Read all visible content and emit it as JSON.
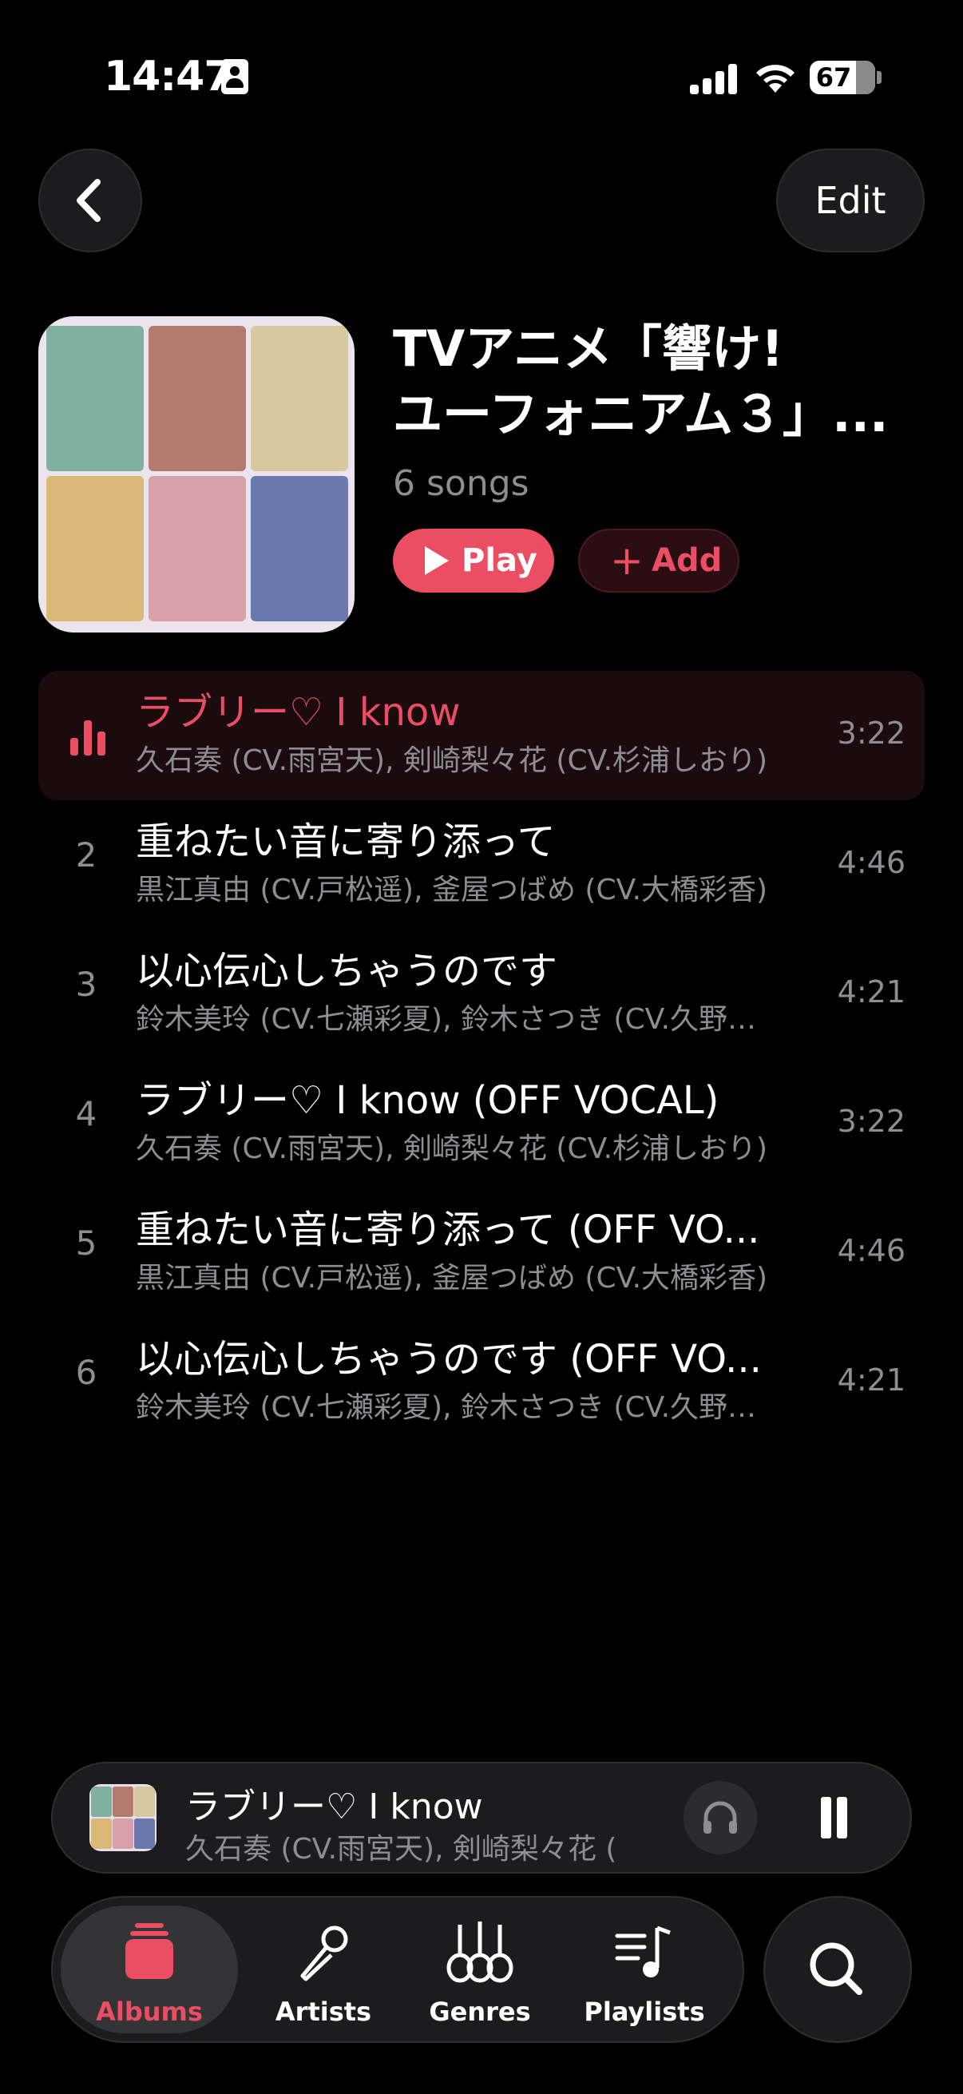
{
  "status": {
    "time": "14:47",
    "battery": "67"
  },
  "nav": {
    "edit_label": "Edit"
  },
  "album": {
    "title_line1": "TVアニメ「響け!",
    "title_line2": "ユーフォニアム３」...",
    "song_count": "6 songs",
    "play_label": "Play",
    "add_label": "Add"
  },
  "tracks": [
    {
      "num": "",
      "title": "ラブリー♡ I know",
      "artist": "久石奏 (CV.雨宮天), 剣崎梨々花 (CV.杉浦しおり)",
      "duration": "3:22",
      "playing": true
    },
    {
      "num": "2",
      "title": "重ねたい音に寄り添って",
      "artist": "黒江真由 (CV.戸松遥), 釜屋つばめ (CV.大橋彩香)",
      "duration": "4:46"
    },
    {
      "num": "3",
      "title": "以心伝心しちゃうのです",
      "artist": "鈴木美玲 (CV.七瀬彩夏), 鈴木さつき (CV.久野…",
      "duration": "4:21"
    },
    {
      "num": "4",
      "title": "ラブリー♡ I know (OFF VOCAL)",
      "artist": "久石奏 (CV.雨宮天), 剣崎梨々花 (CV.杉浦しおり)",
      "duration": "3:22"
    },
    {
      "num": "5",
      "title": "重ねたい音に寄り添って (OFF VO...",
      "artist": "黒江真由 (CV.戸松遥), 釜屋つばめ (CV.大橋彩香)",
      "duration": "4:46"
    },
    {
      "num": "6",
      "title": "以心伝心しちゃうのです (OFF VO...",
      "artist": "鈴木美玲 (CV.七瀬彩夏), 鈴木さつき (CV.久野…",
      "duration": "4:21"
    }
  ],
  "mini_player": {
    "title": "ラブリー♡ I know",
    "artist": "久石奏 (CV.雨宮天), 剣崎梨々花 (..."
  },
  "tabs": [
    {
      "label": "Albums",
      "icon": "albums-icon",
      "active": true
    },
    {
      "label": "Artists",
      "icon": "microphone-icon"
    },
    {
      "label": "Genres",
      "icon": "guitars-icon"
    },
    {
      "label": "Playlists",
      "icon": "playlist-icon"
    }
  ],
  "colors": {
    "accent": "#eb4d63",
    "background": "#000000",
    "secondary_text": "#8d8d92",
    "surface": "#1c1c1e"
  }
}
